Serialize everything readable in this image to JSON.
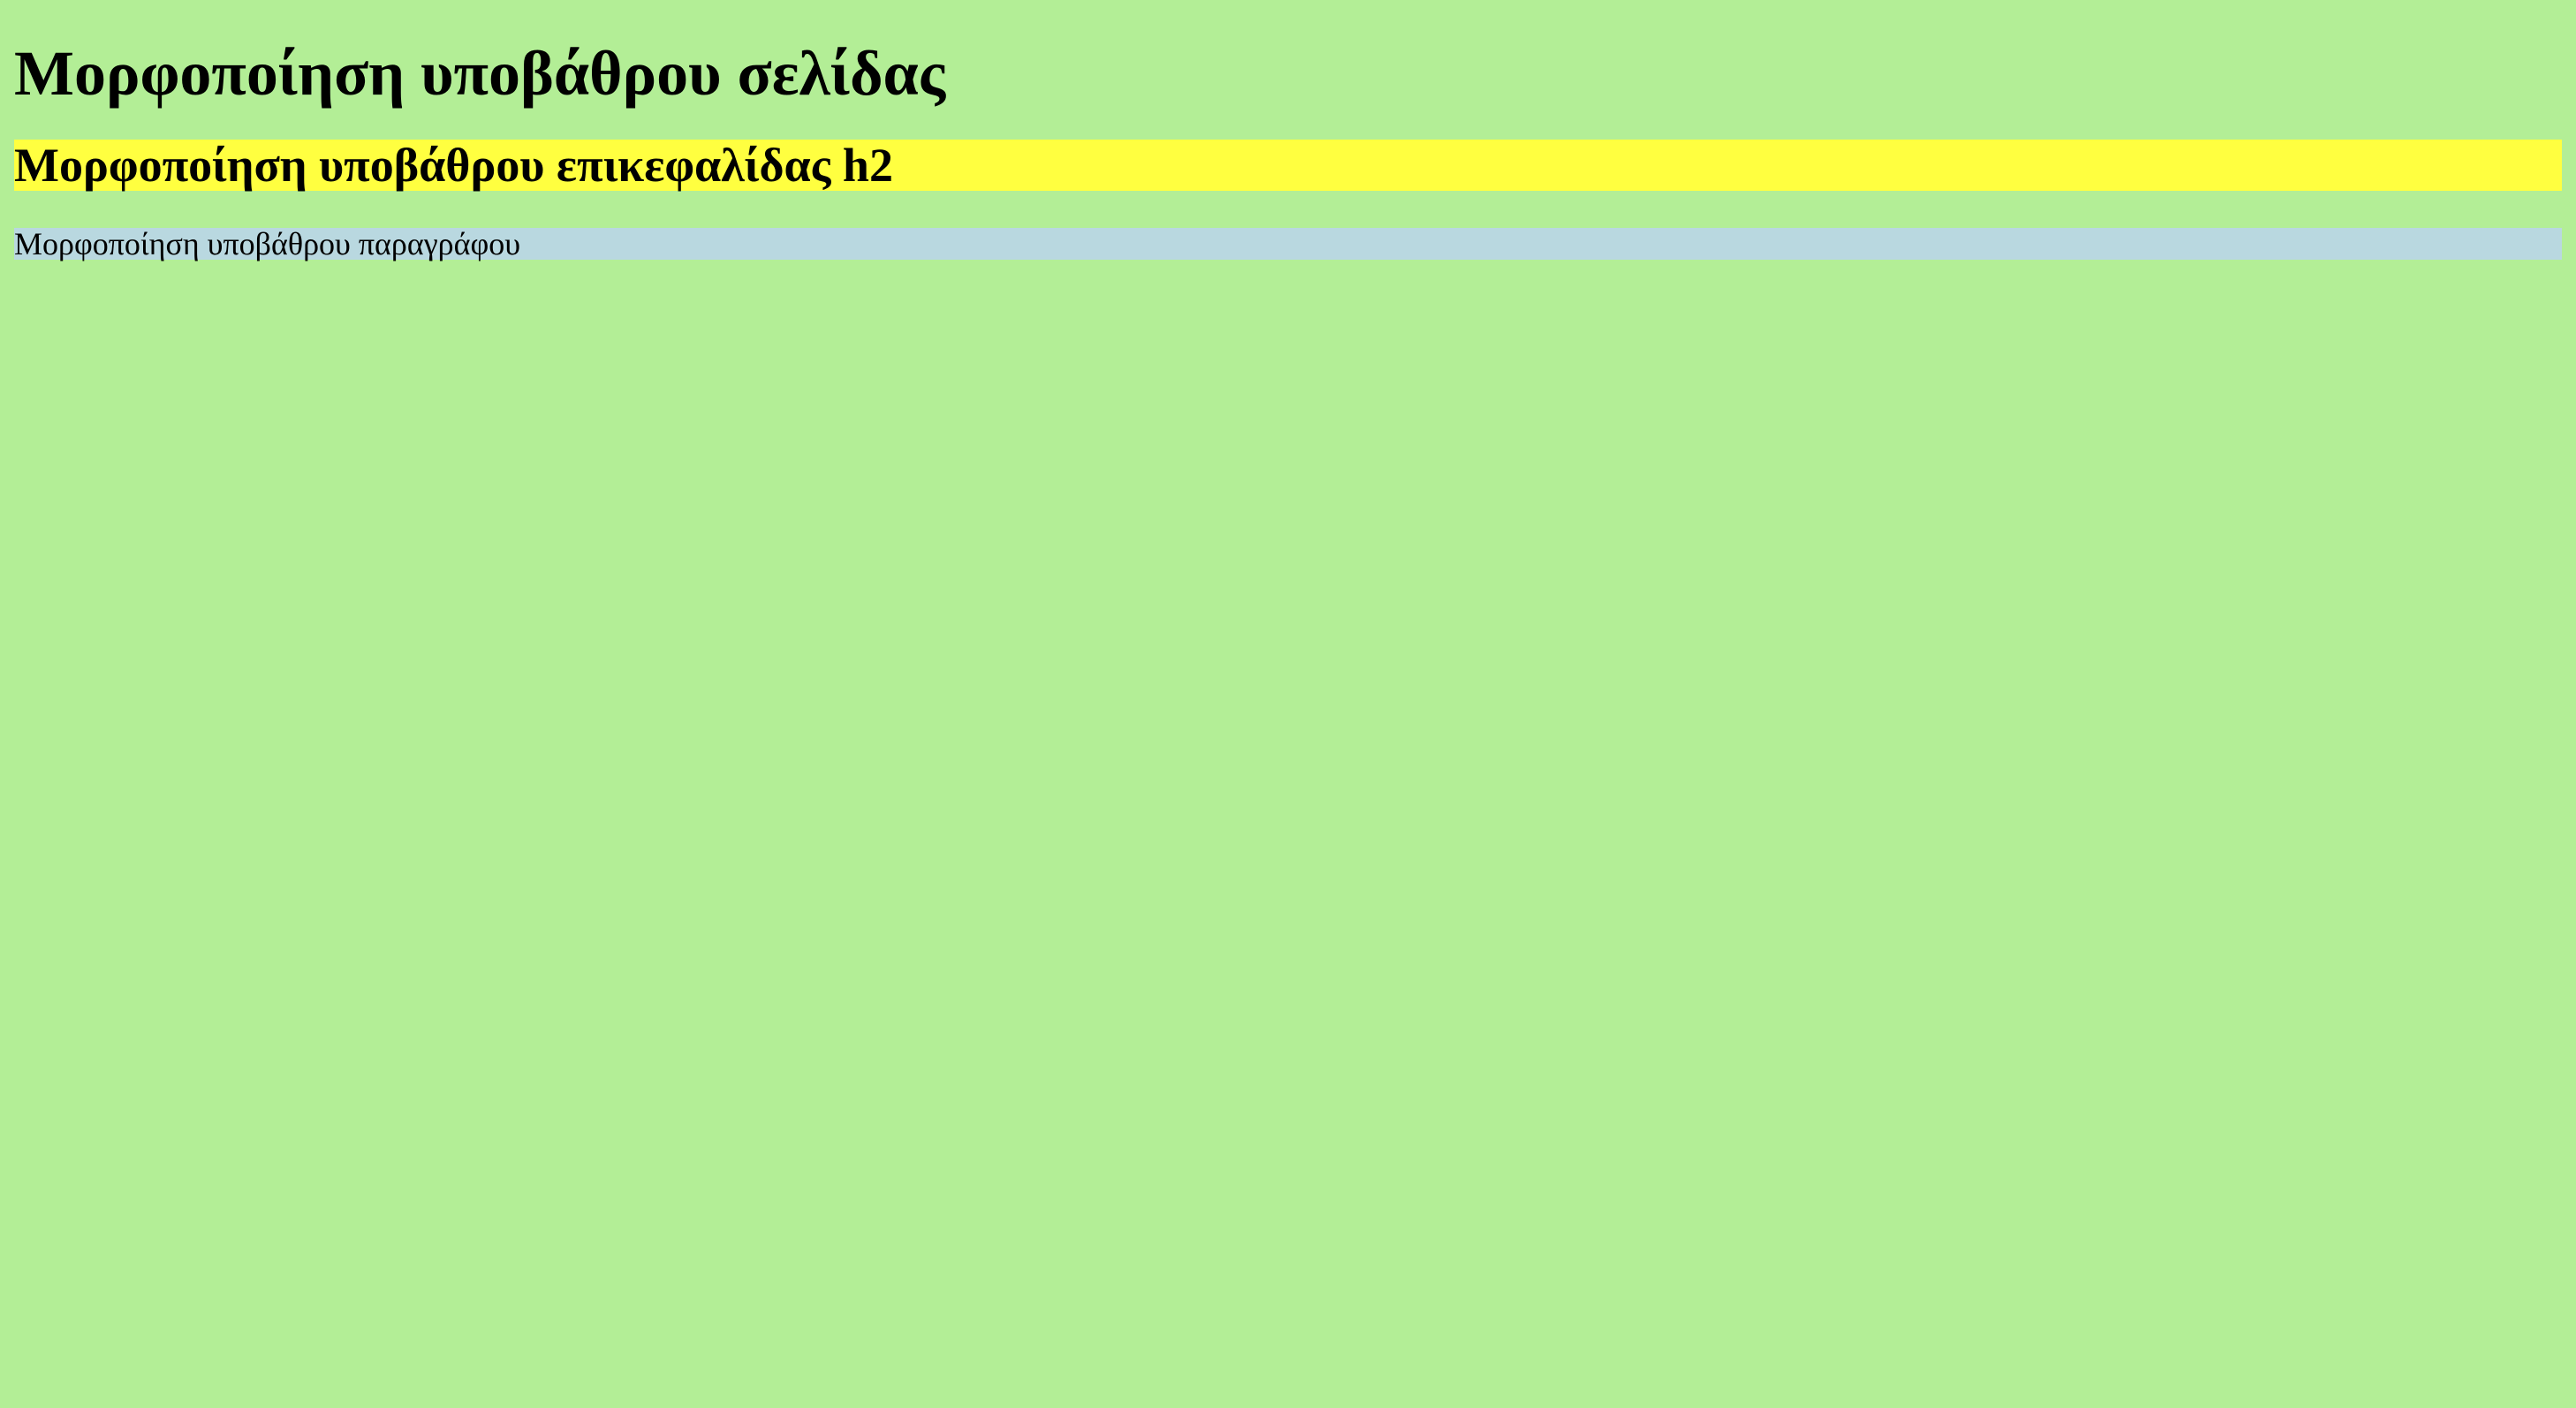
{
  "page": {
    "title": "Μορφοποίηση υποβάθρου σελίδας",
    "background_color": "#b3ee96"
  },
  "heading_h2": {
    "text": "Μορφοποίηση υποβάθρου επικεφαλίδας h2",
    "background_color": "#ffff40"
  },
  "paragraph": {
    "text": "Μορφοποίηση υποβάθρου παραγράφου",
    "background_color": "#b9d8e0"
  }
}
